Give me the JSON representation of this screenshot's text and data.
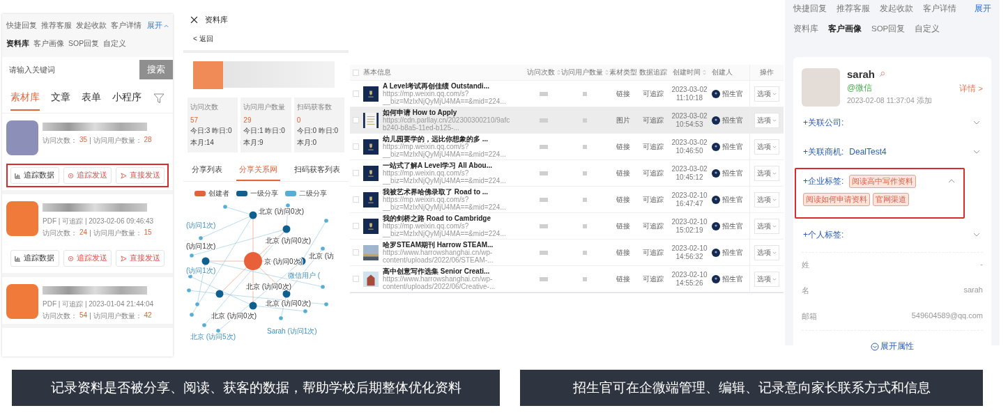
{
  "library_panel": {
    "toolbar_rows": [
      [
        {
          "label": "快捷回复",
          "selected": false
        },
        {
          "label": "推荐客服",
          "selected": false
        },
        {
          "label": "发起收款",
          "selected": false
        },
        {
          "label": "客户详情",
          "selected": false
        }
      ],
      [
        {
          "label": "资料库",
          "selected": true
        },
        {
          "label": "客户画像",
          "selected": false
        },
        {
          "label": "SOP回复",
          "selected": false
        },
        {
          "label": "自定义",
          "selected": false
        }
      ]
    ],
    "expand": "展开",
    "search": {
      "placeholder": "请输入关键词",
      "button": "搜索"
    },
    "tabs": [
      {
        "label": "素材库",
        "selected": true
      },
      {
        "label": "文章",
        "selected": false
      },
      {
        "label": "表单",
        "selected": false
      },
      {
        "label": "小程序",
        "selected": false
      }
    ],
    "cards": [
      {
        "color": "#8c8fb8",
        "visits_label": "访问次数：",
        "visits": "35",
        "users_label": "| 访问用户数量：",
        "users": "28",
        "highlighted": true,
        "actions": [
          {
            "kind": "chart",
            "label": "追踪数据"
          },
          {
            "kind": "target",
            "label": "追踪发送"
          },
          {
            "kind": "send",
            "label": "直接发送"
          }
        ]
      },
      {
        "color": "#f07a3a",
        "meta": "PDF | 可追踪 | 2023-02-06 09:46:43",
        "visits_label": "访问次数：",
        "visits": "24",
        "users_label": "| 访问用户数量：",
        "users": "15",
        "highlighted": false,
        "actions": [
          {
            "kind": "chart",
            "label": "追踪数据"
          },
          {
            "kind": "target",
            "label": "追踪发送"
          },
          {
            "kind": "send",
            "label": "直接发送"
          }
        ]
      },
      {
        "color": "#f07a3a",
        "meta": "PDF | 可追踪 | 2023-01-04 21:44:04",
        "visits_label": "访问次数：",
        "visits": "54",
        "users_label": "| 访问用户数量：",
        "users": "42"
      }
    ]
  },
  "detail_panel": {
    "title": "资料库",
    "back": "< 返回",
    "stats": [
      {
        "label": "访问次数",
        "value": "57",
        "today": "今日:3 昨日:0",
        "month": "本月:14"
      },
      {
        "label": "访问用户数量",
        "value": "29",
        "today": "今日:1 昨日:0",
        "month": "本月:9"
      },
      {
        "label": "扫码获客数",
        "value": "0",
        "today": "今日:0 昨日:0",
        "month": "本月:0"
      }
    ],
    "tabs": [
      {
        "label": "分享列表",
        "selected": false
      },
      {
        "label": "分享关系网",
        "selected": true
      },
      {
        "label": "扫码获客列表",
        "selected": false
      }
    ],
    "legend": [
      {
        "label": "创建者",
        "color": "#e8603a"
      },
      {
        "label": "一级分享",
        "color": "#0f5f8f"
      },
      {
        "label": "二级分享",
        "color": "#56aed6"
      }
    ],
    "graph": {
      "creator_label": "京 (访问0次)",
      "first_level": [
        "北京 (访问0次)",
        "北京 (访问0次)",
        "北京 (访",
        "北京 (访问0次)",
        "北京 (访问0次)",
        "北京 (访问0次)",
        "(访问1次)"
      ],
      "second_level": [
        "(访问1次)",
        "(访问1次)",
        "微信用户 (",
        "Sarah (访问1次)",
        "北京 (访问5次)"
      ]
    }
  },
  "table": {
    "select_all_checked": false,
    "columns": [
      {
        "label": "基本信息",
        "sortable": false
      },
      {
        "label": "访问次数",
        "sortable": true
      },
      {
        "label": "访问用户数量",
        "sortable": true
      },
      {
        "label": "素材类型",
        "sortable": false
      },
      {
        "label": "数据追踪",
        "sortable": false
      },
      {
        "label": "创建时间",
        "sortable": true
      },
      {
        "label": "创建人",
        "sortable": false
      },
      {
        "label": "操作",
        "sortable": false
      }
    ],
    "rows": [
      {
        "kind": "crest",
        "title": "A Level考试再创佳绩 Outstandi...",
        "url": "https://mp.weixin.qq.com/s?",
        "url2": "__biz=MzIxNjQyMjU4MA==&mid=224...",
        "type": "链接",
        "tracking": "可追踪",
        "date": "2023-03-02",
        "time": "11:10:18",
        "creator": "招生官",
        "action": "选项",
        "hovered": false,
        "checked": false
      },
      {
        "kind": "doc",
        "title": "如何申请 How to Apply",
        "url": "https://cdn.parllay.cn/202300300210/9afc",
        "url2": "b240-b8a5-11ed-b125-...",
        "type": "图片",
        "tracking": "可追踪",
        "date": "2023-03-02",
        "time": "10:54:53",
        "creator": "招生官",
        "action": "选项",
        "hovered": true,
        "checked": false
      },
      {
        "kind": "crest",
        "title": "幼儿园要学的，远比你想象的多 ...",
        "url": "https://mp.weixin.qq.com/s?",
        "url2": "__biz=MzIxNjQyMjU4MA==&mid=224...",
        "type": "链接",
        "tracking": "可追踪",
        "date": "2023-03-02",
        "time": "10:46:50",
        "creator": "招生官",
        "action": "选项",
        "hovered": false,
        "checked": false
      },
      {
        "kind": "crest",
        "title": "一站式了解A Level学习 All Abou...",
        "url": "https://mp.weixin.qq.com/s?",
        "url2": "__biz=MzIxNjQyMjU4MA==&mid=224...",
        "type": "链接",
        "tracking": "可追踪",
        "date": "2023-03-02",
        "time": "10:45:12",
        "creator": "招生官",
        "action": "选项",
        "hovered": false,
        "checked": false
      },
      {
        "kind": "crest",
        "title": "我被艺术界哈佛录取了 Road to ...",
        "url": "https://mp.weixin.qq.com/s?",
        "url2": "__biz=MzIxNjQyMjU4MA==&mid=224...",
        "type": "链接",
        "tracking": "可追踪",
        "date": "2023-02-10",
        "time": "16:47:47",
        "creator": "招生官",
        "action": "选项",
        "hovered": false,
        "checked": false
      },
      {
        "kind": "crest",
        "title": "我的剑桥之路 Road to Cambridge",
        "url": "https://mp.weixin.qq.com/s?",
        "url2": "__biz=MzIxNjQyMjU4MA==&mid=224...",
        "type": "链接",
        "tracking": "可追踪",
        "date": "2023-02-10",
        "time": "15:02:19",
        "creator": "招生官",
        "action": "选项",
        "hovered": false,
        "checked": false
      },
      {
        "kind": "magazine",
        "title": "哈罗STEAM期刊 Harrow STEAM...",
        "url": "https://www.harrowshanghai.cn/wp-",
        "url2": "content/uploads/2022/06/STEAM-...",
        "type": "链接",
        "tracking": "可追踪",
        "date": "2023-02-10",
        "time": "14:56:32",
        "creator": "招生官",
        "action": "选项",
        "hovered": false,
        "checked": false
      },
      {
        "kind": "building",
        "title": "高中创意写作选集 Senior Creati...",
        "url": "https://www.harrowshanghai.cn/wp-",
        "url2": "content/uploads/2022/06/Creative-...",
        "type": "链接",
        "tracking": "可追踪",
        "date": "2023-02-10",
        "time": "14:55:26",
        "creator": "招生官",
        "action": "选项",
        "hovered": false,
        "checked": false
      }
    ]
  },
  "customer_panel": {
    "toolbar_rows": [
      [
        {
          "label": "快捷回复",
          "selected": false
        },
        {
          "label": "推荐客服",
          "selected": false
        },
        {
          "label": "发起收款",
          "selected": false
        },
        {
          "label": "客户详情",
          "selected": false
        }
      ],
      [
        {
          "label": "资料库",
          "selected": false
        },
        {
          "label": "客户画像",
          "selected": true
        },
        {
          "label": "SOP回复",
          "selected": false
        },
        {
          "label": "自定义",
          "selected": false
        }
      ]
    ],
    "expand": "展开",
    "name": "sarah",
    "source": "@微信",
    "added": "2023-02-08 11:37:04 添加",
    "details": "详情 >",
    "fields": [
      {
        "label": "+关联公司:",
        "expanded": false,
        "highlighted": false
      },
      {
        "label": "+关联商机:",
        "value": "DealTest4",
        "expanded": false,
        "highlighted": false
      },
      {
        "label": "+企业标签:",
        "expanded": true,
        "highlighted": true,
        "tags": [
          "阅读高中写作资料",
          "阅读如何申请资料",
          "官网渠道"
        ]
      },
      {
        "label": "+个人标签:",
        "expanded": false,
        "highlighted": false
      }
    ],
    "attributes": [
      {
        "label": "姓",
        "value": "-"
      },
      {
        "label": "名",
        "value": "sarah"
      },
      {
        "label": "邮箱",
        "value": "549604589@qq.com"
      }
    ],
    "more": "展开属性"
  },
  "captions": [
    "记录资料是否被分享、阅读、获客的数据，帮助学校后期整体优化资料",
    "招生官可在企微端管理、编辑、记录意向家长联系方式和信息"
  ]
}
